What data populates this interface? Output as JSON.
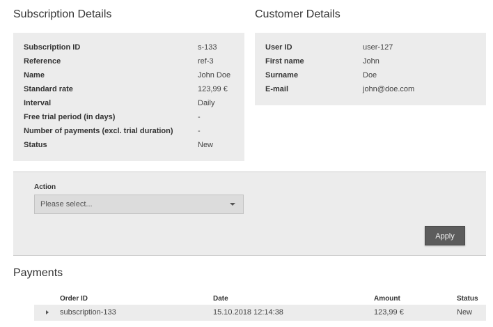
{
  "subscription": {
    "title": "Subscription Details",
    "rows": [
      {
        "label": "Subscription ID",
        "value": "s-133"
      },
      {
        "label": "Reference",
        "value": "ref-3"
      },
      {
        "label": "Name",
        "value": "John Doe"
      },
      {
        "label": "Standard rate",
        "value": "123,99 €"
      },
      {
        "label": "Interval",
        "value": "Daily"
      },
      {
        "label": "Free trial period (in days)",
        "value": "-"
      },
      {
        "label": "Number of payments (excl. trial duration)",
        "value": "-"
      },
      {
        "label": "Status",
        "value": "New"
      }
    ]
  },
  "customer": {
    "title": "Customer Details",
    "rows": [
      {
        "label": "User ID",
        "value": "user-127"
      },
      {
        "label": "First name",
        "value": "John"
      },
      {
        "label": "Surname",
        "value": "Doe"
      },
      {
        "label": "E-mail",
        "value": "john@doe.com"
      }
    ]
  },
  "action": {
    "label": "Action",
    "select_value": "Please select...",
    "apply_label": "Apply"
  },
  "payments": {
    "title": "Payments",
    "columns": [
      "Order ID",
      "Date",
      "Amount",
      "Status"
    ],
    "rows": [
      {
        "order_id": "subscription-133",
        "date": "15.10.2018 12:14:38",
        "amount": "123,99 €",
        "status": "New"
      }
    ]
  },
  "icons": {
    "select_caret": "chevron-down-icon",
    "row_expand": "chevron-right-icon"
  }
}
